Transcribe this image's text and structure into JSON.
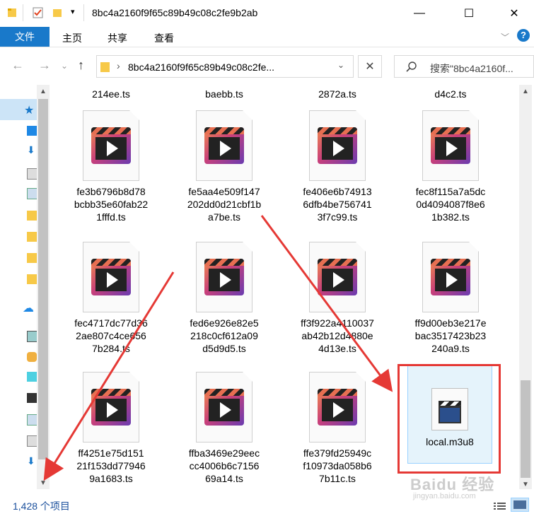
{
  "window": {
    "title": "8bc4a2160f9f65c89b49c08c2fe9b2ab",
    "minimize_symbol": "—",
    "maximize_symbol": "☐",
    "close_symbol": "✕"
  },
  "ribbon": {
    "file_label": "文件",
    "tabs": [
      "主页",
      "共享",
      "查看"
    ]
  },
  "address": {
    "path_text": "8bc4a2160f9f65c89b49c08c2fe...",
    "search_placeholder": "搜索\"8bc4a2160f..."
  },
  "files_top_row": [
    "214ee.ts",
    "baebb.ts",
    "2872a.ts",
    "d4c2.ts"
  ],
  "files": [
    {
      "label": "fe3b6796b8d78\nbcbb35e60fab22\n1fffd.ts"
    },
    {
      "label": "fe5aa4e509f147\n202dd0d21cbf1b\na7be.ts"
    },
    {
      "label": "fe406e6b74913\n6dfb4be756741\n3f7c99.ts"
    },
    {
      "label": "fec8f115a7a5dc\n0d4094087f8e6\n1b382.ts"
    },
    {
      "label": "fec4717dc77d36\n2ae807c4ce656\n7b284.ts"
    },
    {
      "label": "fed6e926e82e5\n218c0cf612a09\nd5d9d5.ts"
    },
    {
      "label": "ff3f922a4110037\nab42b12d4880e\n4d13e.ts"
    },
    {
      "label": "ff9d00eb3e217e\nbac3517423b23\n240a9.ts"
    },
    {
      "label": "ff4251e75d151\n21f153dd77946\n9a1683.ts"
    },
    {
      "label": "ffba3469e29eec\ncc4006b6c7156\n69a14.ts"
    },
    {
      "label": "ffe379fd25949c\nf10973da058b6\n7b11c.ts"
    }
  ],
  "selected_file": {
    "label": "local.m3u8"
  },
  "status": {
    "count": "1,428 个项目"
  },
  "watermark": {
    "brand": "Baidu 经验",
    "url": "jingyan.baidu.com"
  }
}
